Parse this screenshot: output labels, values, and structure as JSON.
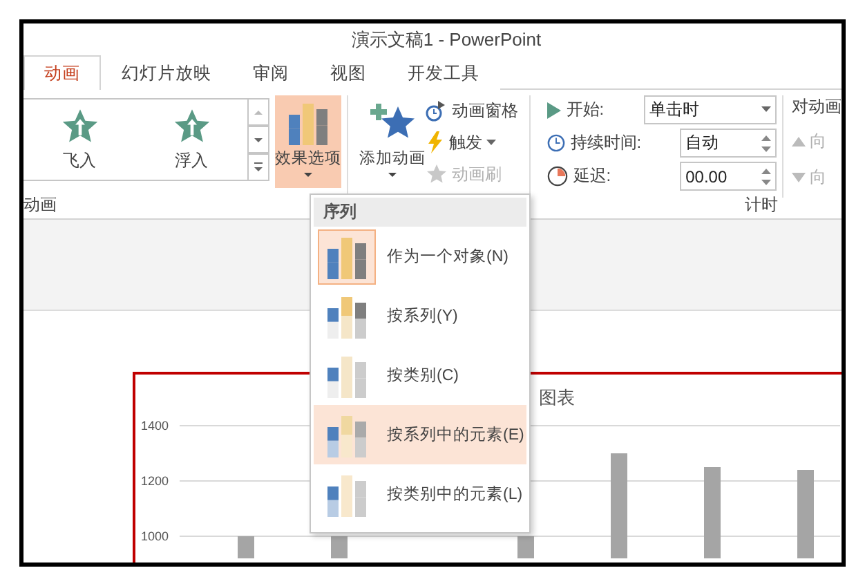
{
  "window": {
    "title": "演示文稿1 - PowerPoint"
  },
  "tabs": [
    {
      "label": "动画",
      "selected": true
    },
    {
      "label": "幻灯片放映",
      "selected": false
    },
    {
      "label": "审阅",
      "selected": false
    },
    {
      "label": "视图",
      "selected": false
    },
    {
      "label": "开发工具",
      "selected": false
    }
  ],
  "ribbon": {
    "gallery": [
      {
        "label": "飞入"
      },
      {
        "label": "浮入"
      }
    ],
    "effect_options": {
      "label": "效果选项",
      "open": true
    },
    "add_animation": {
      "label": "添加动画"
    },
    "advanced": [
      {
        "label": "动画窗格",
        "kind": "pane",
        "disabled": false,
        "dropdown": false
      },
      {
        "label": "触发",
        "kind": "trigger",
        "disabled": false,
        "dropdown": true
      },
      {
        "label": "动画刷",
        "kind": "painter",
        "disabled": true,
        "dropdown": false
      }
    ],
    "timing": {
      "start_label": "开始:",
      "start_value": "单击时",
      "duration_label": "持续时间:",
      "duration_value": "自动",
      "delay_label": "延迟:",
      "delay_value": "00.00"
    },
    "reorder": {
      "label": "对动画",
      "items": [
        {
          "label": "向",
          "kind": "up",
          "disabled": true
        },
        {
          "label": "向",
          "kind": "down",
          "disabled": true
        }
      ]
    },
    "groups": [
      "动画",
      "计时"
    ]
  },
  "menu": {
    "header": "序列",
    "items": [
      {
        "label": "作为一个对象(N)",
        "kind": "object",
        "selected": true,
        "hovered": false
      },
      {
        "label": "按系列(Y)",
        "kind": "series",
        "selected": false,
        "hovered": false
      },
      {
        "label": "按类别(C)",
        "kind": "category",
        "selected": false,
        "hovered": false
      },
      {
        "label": "按系列中的元素(E)",
        "kind": "series_element",
        "selected": false,
        "hovered": true
      },
      {
        "label": "按类别中的元素(L)",
        "kind": "category_element",
        "selected": false,
        "hovered": false
      }
    ]
  },
  "slide": {
    "title": "图表",
    "chart_data": {
      "type": "bar",
      "ylim": [
        920,
        1400
      ],
      "grid": true,
      "yticks": [
        1000,
        1200,
        1400
      ],
      "values": [
        1000,
        1000,
        null,
        1000,
        1300,
        1250,
        1240
      ]
    }
  }
}
